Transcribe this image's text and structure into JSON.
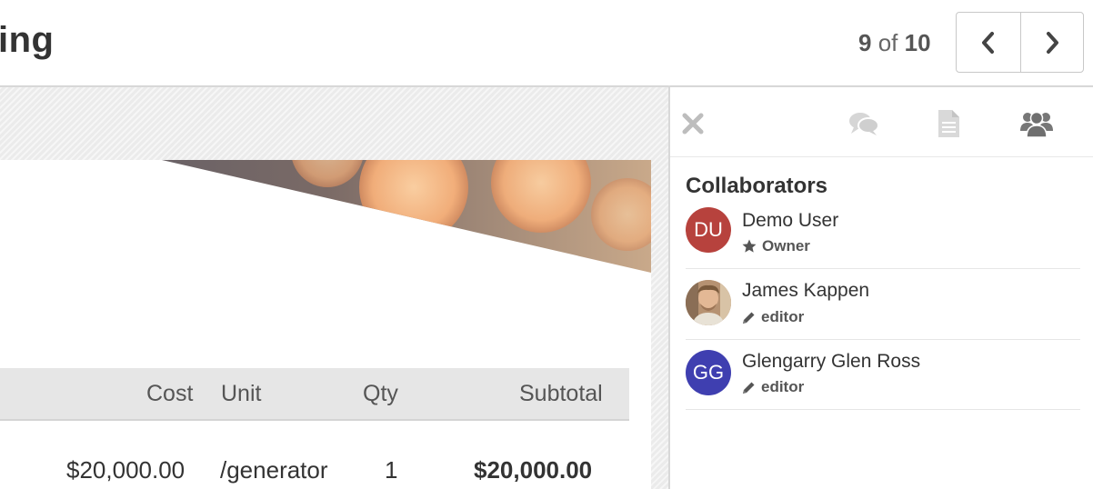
{
  "header": {
    "title": "ing",
    "pager": {
      "current": "9",
      "of_label": "of",
      "total": "10"
    },
    "prev_icon": "chevron-left-icon",
    "next_icon": "chevron-right-icon"
  },
  "document": {
    "table": {
      "columns": [
        "Cost",
        "Unit",
        "Qty",
        "Subtotal"
      ],
      "rows": [
        {
          "cost": "$20,000.00",
          "unit": "/generator",
          "qty": "1",
          "subtotal": "$20,000.00"
        }
      ]
    }
  },
  "panel": {
    "tabs": [
      "close-icon",
      "comments-icon",
      "document-icon",
      "users-icon"
    ],
    "title": "Collaborators",
    "collaborators": [
      {
        "initials": "DU",
        "name": "Demo User",
        "role": "Owner",
        "role_icon": "star-icon",
        "color": "#b7423d"
      },
      {
        "initials": "",
        "name": "James Kappen",
        "role": "editor",
        "role_icon": "pencil-icon",
        "color": "#c9a27a"
      },
      {
        "initials": "GG",
        "name": "Glengarry Glen Ross",
        "role": "editor",
        "role_icon": "pencil-icon",
        "color": "#3f3fb0"
      }
    ]
  }
}
